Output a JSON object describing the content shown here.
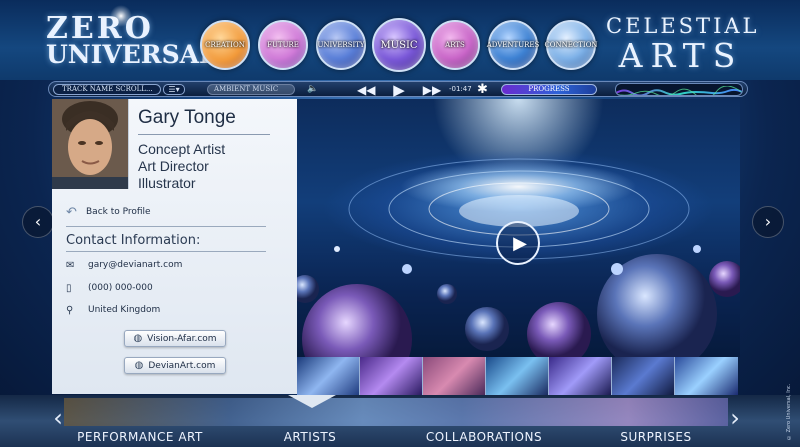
{
  "header": {
    "logo_left_line1": "ZERO",
    "logo_left_line2": "UNIVERSAL",
    "logo_right_line1": "CELESTIAL",
    "logo_right_line2": "ARTS",
    "nav": [
      {
        "label": "CREATION",
        "color": "#f29a3a"
      },
      {
        "label": "FUTURE",
        "color": "#d07bd8"
      },
      {
        "label": "UNIVERSITY",
        "color": "#5a7fd8"
      },
      {
        "label": "MUSIC",
        "color": "#7a58d8"
      },
      {
        "label": "ARTS",
        "color": "#c966c8"
      },
      {
        "label": "ADVENTURES",
        "color": "#3f83d4"
      },
      {
        "label": "CONNECTION",
        "color": "#7fb2e8"
      }
    ]
  },
  "player": {
    "track_placeholder": "TRACK NAME SCROLL...",
    "ambient_label": "AMBIENT MUSIC",
    "time": "-01:47",
    "progress_label": "PROGRESS"
  },
  "profile": {
    "name": "Gary Tonge",
    "roles": [
      "Concept Artist",
      "Art Director",
      "Illustrator"
    ],
    "back_label": "Back to Profile",
    "contact_title": "Contact Information:",
    "email": "gary@devianart.com",
    "phone": "(000) 000-000",
    "location": "United Kingdom",
    "links": [
      "Vision-Afar.com",
      "DevianArt.com"
    ]
  },
  "bottom_nav": [
    "PERFORMANCE ART",
    "ARTISTS",
    "COLLABORATIONS",
    "SURPRISES"
  ],
  "copyright": "© Zero Universal, Inc."
}
